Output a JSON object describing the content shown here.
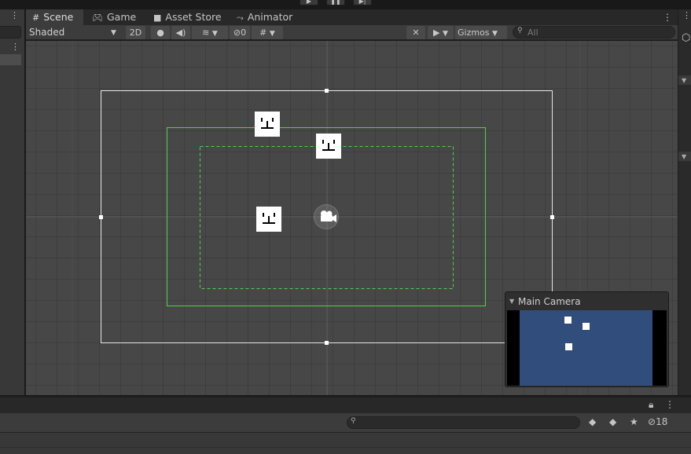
{
  "tabs": [
    {
      "label": "Scene",
      "icon": "grid-icon",
      "active": true
    },
    {
      "label": "Game",
      "icon": "gamepad-icon",
      "active": false
    },
    {
      "label": "Asset Store",
      "icon": "shopping-bag-icon",
      "active": false
    },
    {
      "label": "Animator",
      "icon": "animator-icon",
      "active": false
    }
  ],
  "toolbar": {
    "shading_mode": "Shaded",
    "mode_2d_label": "2D",
    "hidden_count": "0",
    "gizmos_label": "Gizmos",
    "search_placeholder": "All"
  },
  "scene": {
    "background": "#474747",
    "camera_frame_color": "#e6e6e6",
    "green_frame_color": "#4cd14c",
    "sprite_count": 3
  },
  "camera_preview": {
    "title": "Main Camera",
    "background": "#304d7b"
  },
  "project_panel": {
    "hidden_packages_count": "18"
  }
}
